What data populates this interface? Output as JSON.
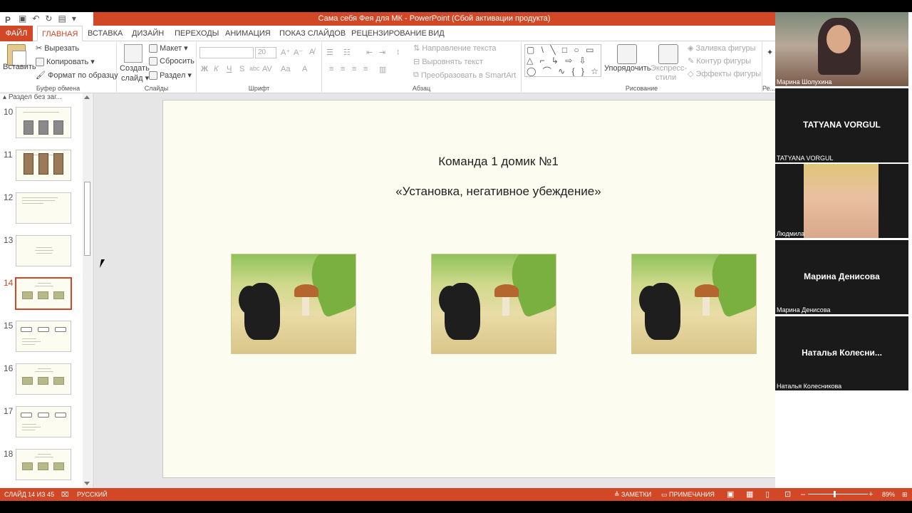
{
  "window": {
    "title": "Сама себя Фея для МК -  PowerPoint (Сбой активации продукта)",
    "app_icon": "P"
  },
  "tabs": {
    "file": "ФАЙЛ",
    "home": "ГЛАВНАЯ",
    "insert": "ВСТАВКА",
    "design": "ДИЗАЙН",
    "transitions": "ПЕРЕХОДЫ",
    "animations": "АНИМАЦИЯ",
    "slideshow": "ПОКАЗ СЛАЙДОВ",
    "review": "РЕЦЕНЗИРОВАНИЕ",
    "view": "ВИД"
  },
  "ribbon": {
    "clipboard": {
      "paste": "Вставить",
      "cut": "Вырезать",
      "copy": "Копировать",
      "format_painter": "Формат по образцу",
      "label": "Буфер обмена"
    },
    "slides": {
      "new_slide_1": "Создать",
      "new_slide_2": "слайд",
      "layout": "Макет",
      "reset": "Сбросить",
      "section": "Раздел",
      "label": "Слайды"
    },
    "font": {
      "size": "20",
      "bold": "Ж",
      "italic": "К",
      "underline": "Ч",
      "strike": "S",
      "shadow": "abc",
      "spacing": "AV",
      "case": "Aa",
      "color": "A",
      "label": "Шрифт"
    },
    "paragraph": {
      "text_direction": "Направление текста",
      "align_text": "Выровнять текст",
      "smartart": "Преобразовать в SmartArt",
      "label": "Абзац"
    },
    "drawing": {
      "shapes": "▢ \\ ╲ □ ○ ▭ △ ⌐ ↳ ⇨ ⇩ ◯ ⌒ ∿ { } ☆",
      "arrange": "Упорядочить",
      "quick_styles_1": "Экспресс-",
      "quick_styles_2": "стили",
      "fill": "Заливка фигуры",
      "outline": "Контур фигуры",
      "effects": "Эффекты фигуры",
      "label": "Рисование"
    },
    "editing": {
      "label": "Ре..."
    }
  },
  "thumbnails": {
    "section": "Раздел без заг...",
    "items": [
      {
        "num": "10",
        "kind": "pics-gray"
      },
      {
        "num": "11",
        "kind": "pics-brown"
      },
      {
        "num": "12",
        "kind": "text"
      },
      {
        "num": "13",
        "kind": "text-center"
      },
      {
        "num": "14",
        "kind": "fairy",
        "active": true
      },
      {
        "num": "15",
        "kind": "boxes"
      },
      {
        "num": "16",
        "kind": "fairy"
      },
      {
        "num": "17",
        "kind": "boxes"
      },
      {
        "num": "18",
        "kind": "fairy"
      }
    ]
  },
  "slide": {
    "title": "Команда 1 домик №1",
    "subtitle": "«Установка, негативное убеждение»"
  },
  "status": {
    "slide_counter": "СЛАЙД 14 ИЗ 45",
    "language": "РУССКИЙ",
    "notes": "ЗАМЕТКИ",
    "comments": "ПРИМЕЧАНИЯ",
    "zoom": "89%"
  },
  "participants": [
    {
      "name": "Марина Шолухина",
      "type": "video"
    },
    {
      "name": "TATYANA VORGUL",
      "display": "TATYANA VORGUL",
      "type": "name"
    },
    {
      "name": "Людмила",
      "type": "video"
    },
    {
      "name": "Марина Денисова",
      "display": "Марина Денисова",
      "type": "name"
    },
    {
      "name": "Наталья Колесникова",
      "display": "Наталья  Колесни...",
      "type": "name"
    }
  ]
}
